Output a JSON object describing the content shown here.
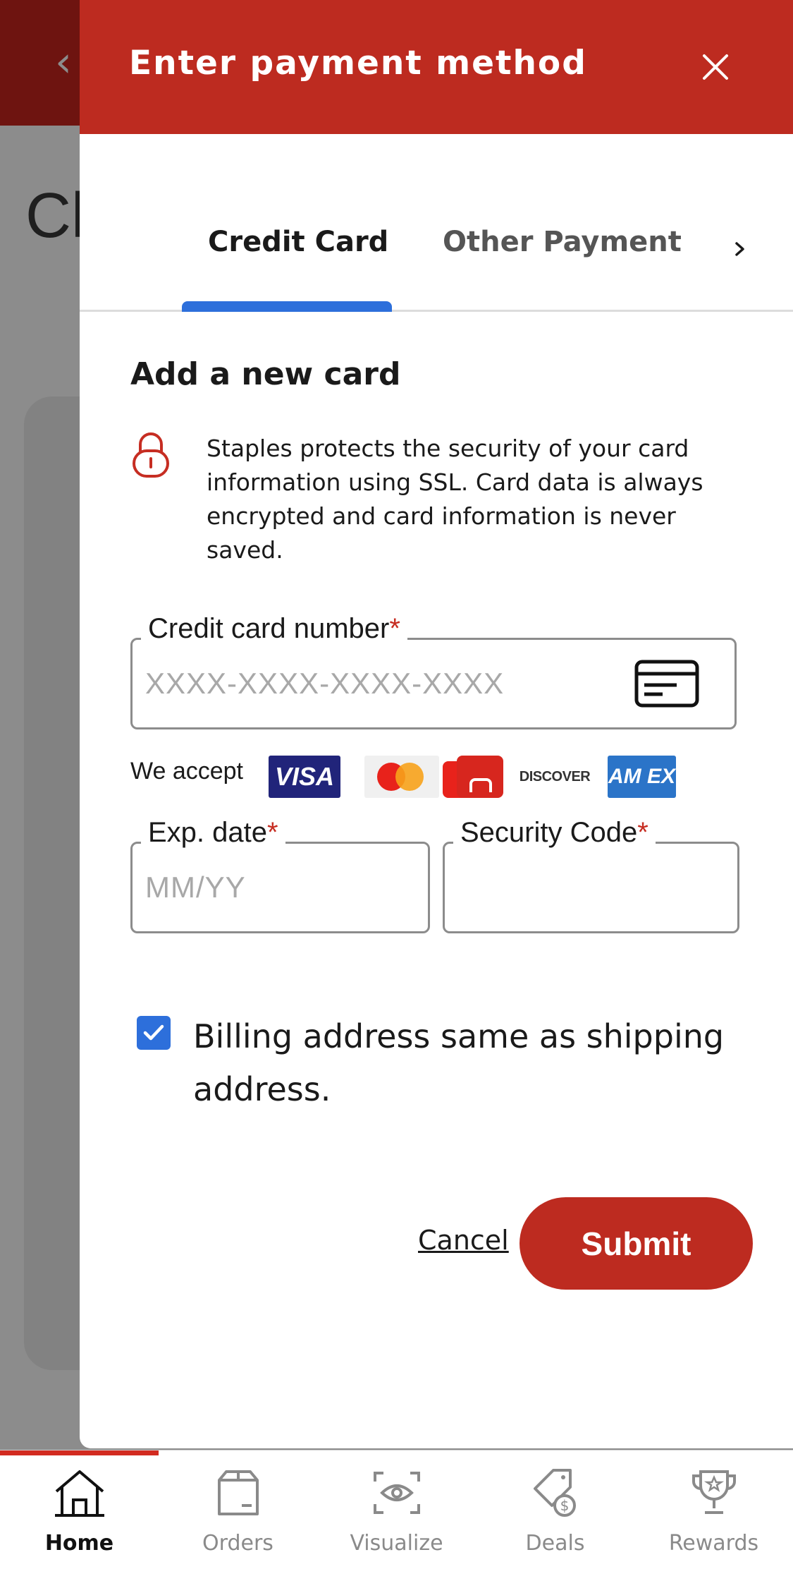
{
  "background": {
    "title_fragment": "Cl",
    "back_icon": "chevron-left-icon"
  },
  "modal": {
    "title": "Enter payment method",
    "close_icon": "close-icon"
  },
  "tabs": [
    {
      "label": "Credit Card",
      "active": true
    },
    {
      "label": "Other Payment",
      "active": false
    }
  ],
  "form": {
    "section_title": "Add a new card",
    "security_note": "Staples protects the security of your card information using SSL. Card data is always encrypted and card information is never saved.",
    "card_number": {
      "label": "Credit card number",
      "required": "*",
      "placeholder": "XXXX-XXXX-XXXX-XXXX",
      "value": ""
    },
    "we_accept": "We accept",
    "accepted_cards": [
      "VISA",
      "Mastercard",
      "JCB",
      "DISCOVER",
      "AMEX"
    ],
    "visa_text": "VISA",
    "discover_text": "DISCOVER",
    "amex_text": "AM EX",
    "exp_date": {
      "label": "Exp. date",
      "required": "*",
      "placeholder": "MM/YY",
      "value": ""
    },
    "security_code": {
      "label": "Security Code",
      "required": "*",
      "placeholder": "",
      "value": ""
    },
    "billing_checkbox": {
      "label": "Billing address same as shipping address.",
      "checked": true
    },
    "cancel_label": "Cancel",
    "submit_label": "Submit"
  },
  "bottom_nav": [
    {
      "label": "Home",
      "icon": "home-icon",
      "active": true
    },
    {
      "label": "Orders",
      "icon": "box-icon",
      "active": false
    },
    {
      "label": "Visualize",
      "icon": "eye-scan-icon",
      "active": false
    },
    {
      "label": "Deals",
      "icon": "price-tag-icon",
      "active": false
    },
    {
      "label": "Rewards",
      "icon": "trophy-icon",
      "active": false
    }
  ],
  "colors": {
    "brand_red": "#bd2b20",
    "accent_blue": "#2d6fdb"
  }
}
